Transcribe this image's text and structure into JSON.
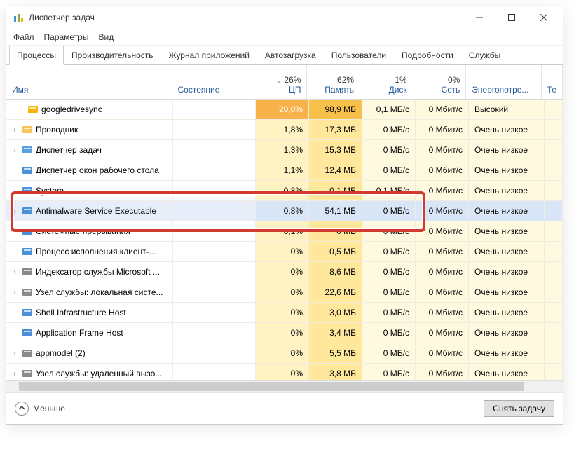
{
  "window": {
    "title": "Диспетчер задач",
    "controls": {
      "min": "min",
      "max": "max",
      "close": "close"
    }
  },
  "menu": {
    "file": "Файл",
    "options": "Параметры",
    "view": "Вид"
  },
  "tabs": {
    "processes": "Процессы",
    "performance": "Производительность",
    "app_history": "Журнал приложений",
    "startup": "Автозагрузка",
    "users": "Пользователи",
    "details": "Подробности",
    "services": "Службы"
  },
  "columns": {
    "name": "Имя",
    "status": "Состояние",
    "cpu_pct": "26%",
    "cpu_label": "ЦП",
    "mem_pct": "62%",
    "mem_label": "Память",
    "disk_pct": "1%",
    "disk_label": "Диск",
    "net_pct": "0%",
    "net_label": "Сеть",
    "power_label": "Энергопотре...",
    "extra_label": "Те"
  },
  "rows": [
    {
      "expand": "",
      "icon": "drive",
      "name": "googledrivesync",
      "cpu": "20,0%",
      "mem": "98,9 МБ",
      "disk": "0,1 МБ/с",
      "net": "0 Мбит/с",
      "power": "Высокий",
      "hot": true
    },
    {
      "expand": "›",
      "icon": "explorer",
      "name": "Проводник",
      "cpu": "1,8%",
      "mem": "17,3 МБ",
      "disk": "0 МБ/с",
      "net": "0 Мбит/с",
      "power": "Очень низкое"
    },
    {
      "expand": "›",
      "icon": "taskmgr",
      "name": "Диспетчер задач",
      "cpu": "1,3%",
      "mem": "15,3 МБ",
      "disk": "0 МБ/с",
      "net": "0 Мбит/с",
      "power": "Очень низкое"
    },
    {
      "expand": "",
      "icon": "dwm",
      "name": "Диспетчер окон рабочего стола",
      "cpu": "1,1%",
      "mem": "12,4 МБ",
      "disk": "0 МБ/с",
      "net": "0 Мбит/с",
      "power": "Очень низкое"
    },
    {
      "expand": "",
      "icon": "system",
      "name": "System",
      "cpu": "0,8%",
      "mem": "0,1 МБ",
      "disk": "0,1 МБ/с",
      "net": "0 Мбит/с",
      "power": "Очень низкое"
    },
    {
      "expand": "›",
      "icon": "defender",
      "name": "Antimalware Service Executable",
      "cpu": "0,8%",
      "mem": "54,1 МБ",
      "disk": "0 МБ/с",
      "net": "0 Мбит/с",
      "power": "Очень низкое",
      "selected": true
    },
    {
      "expand": "",
      "icon": "system",
      "name": "Системные прерывания",
      "cpu": "0,1%",
      "mem": "0 МБ",
      "disk": "0 МБ/с",
      "net": "0 Мбит/с",
      "power": "Очень низкое"
    },
    {
      "expand": "",
      "icon": "client",
      "name": "Процесс исполнения клиент-...",
      "cpu": "0%",
      "mem": "0,5 МБ",
      "disk": "0 МБ/с",
      "net": "0 Мбит/с",
      "power": "Очень низкое"
    },
    {
      "expand": "›",
      "icon": "indexer",
      "name": "Индексатор службы Microsoft ...",
      "cpu": "0%",
      "mem": "8,6 МБ",
      "disk": "0 МБ/с",
      "net": "0 Мбит/с",
      "power": "Очень низкое"
    },
    {
      "expand": "›",
      "icon": "svchost",
      "name": "Узел службы: локальная систе...",
      "cpu": "0%",
      "mem": "22,6 МБ",
      "disk": "0 МБ/с",
      "net": "0 Мбит/с",
      "power": "Очень низкое"
    },
    {
      "expand": "",
      "icon": "shell",
      "name": "Shell Infrastructure Host",
      "cpu": "0%",
      "mem": "3,0 МБ",
      "disk": "0 МБ/с",
      "net": "0 Мбит/с",
      "power": "Очень низкое"
    },
    {
      "expand": "",
      "icon": "frame",
      "name": "Application Frame Host",
      "cpu": "0%",
      "mem": "3,4 МБ",
      "disk": "0 МБ/с",
      "net": "0 Мбит/с",
      "power": "Очень низкое"
    },
    {
      "expand": "›",
      "icon": "group",
      "name": "appmodel (2)",
      "cpu": "0%",
      "mem": "5,5 МБ",
      "disk": "0 МБ/с",
      "net": "0 Мбит/с",
      "power": "Очень низкое"
    },
    {
      "expand": "›",
      "icon": "svchost",
      "name": "Узел службы: удаленный вызо...",
      "cpu": "0%",
      "mem": "3,8 МБ",
      "disk": "0 МБ/с",
      "net": "0 Мбит/с",
      "power": "Очень низкое"
    }
  ],
  "footer": {
    "less": "Меньше",
    "end_task": "Снять задачу"
  },
  "icons": {
    "drive": "#f5b400",
    "explorer": "#f7c65b",
    "taskmgr": "#5aa0e6",
    "dwm": "#4a90d9",
    "system": "#4a90d9",
    "defender": "#4a90d9",
    "client": "#4a90d9",
    "indexer": "#8a8a8a",
    "svchost": "#8a8a8a",
    "shell": "#4a90d9",
    "frame": "#4a90d9",
    "group": "#8a8a8a"
  }
}
